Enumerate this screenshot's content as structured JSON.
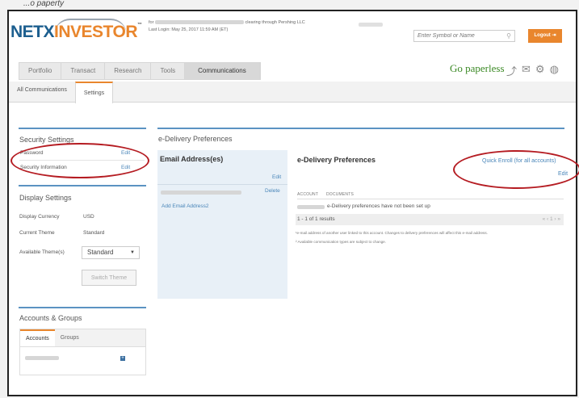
{
  "page_caption": "...o paperty",
  "header": {
    "logo_part1": "NETX",
    "logo_part2": "INVESTOR",
    "logo_tm": "™",
    "for_label": "for",
    "clearing_text": "clearing through Pershing LLC",
    "last_login": "Last Login: May 25, 2017 11:59 AM (ET)",
    "search_placeholder": "Enter Symbol or Name",
    "logout_label": "Logout",
    "go_paperless": "Go paperless"
  },
  "nav_tabs": [
    {
      "label": "Portfolio"
    },
    {
      "label": "Transact"
    },
    {
      "label": "Research"
    },
    {
      "label": "Tools"
    },
    {
      "label": "Communications"
    }
  ],
  "sub_tabs": [
    {
      "label": "All Communications"
    },
    {
      "label": "Settings"
    }
  ],
  "security_settings": {
    "title": "Security Settings",
    "rows": [
      {
        "label": "Password",
        "action": "Edit"
      },
      {
        "label": "Security Information",
        "action": "Edit"
      }
    ]
  },
  "display_settings": {
    "title": "Display Settings",
    "currency_label": "Display Currency",
    "currency_value": "USD",
    "theme_label": "Current Theme",
    "theme_value": "Standard",
    "available_label": "Available Theme(s)",
    "available_value": "Standard",
    "switch_label": "Switch Theme"
  },
  "accounts_groups": {
    "title": "Accounts & Groups",
    "tabs": [
      "Accounts",
      "Groups"
    ],
    "plus": "+"
  },
  "delivery": {
    "section_title": "e-Delivery Preferences",
    "email_title": "Email Address(es)",
    "email_edit": "Edit",
    "email_delete": "Delete",
    "add_email": "Add Email Address2",
    "pref_title": "e-Delivery Preferences",
    "quick_enroll": "Quick Enroll (for all accounts)",
    "pref_edit": "Edit",
    "col_account": "ACCOUNT",
    "col_documents": "DOCUMENTS",
    "not_setup": "e-Delivery preferences have not been set up",
    "results": "1 - 1 of 1 results",
    "pager": "« ‹ 1 › »",
    "footnote1": "¹e-mail address of another user linked to this account. Changes to delivery preferences will affect this e-mail address.",
    "footnote2": "² Available communication types are subject to change."
  },
  "colors": {
    "accent_orange": "#e9862d",
    "brand_blue": "#1d5f8f",
    "link_blue": "#4a86b9",
    "paperless_green": "#3c8a26",
    "annotation_red": "#b51c22"
  }
}
